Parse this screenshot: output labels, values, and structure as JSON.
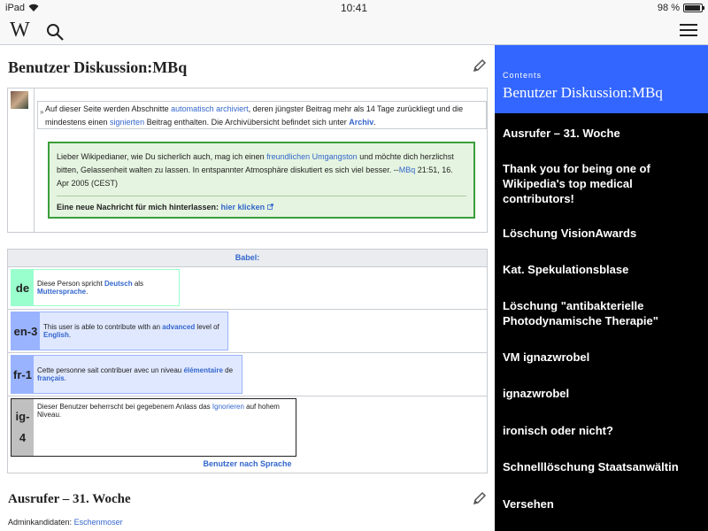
{
  "status": {
    "carrier": "iPad",
    "time": "10:41",
    "battery": "98 %"
  },
  "toolbar": {
    "logo": "W",
    "icons": [
      "wikipedia-logo",
      "search-icon",
      "menu-icon"
    ]
  },
  "page": {
    "title": "Benutzer Diskussion:MBq"
  },
  "archive_note": {
    "t1": "Auf dieser Seite werden Abschnitte ",
    "l1": "automatisch archiviert",
    "t2": ", deren jüngster Beitrag mehr als 14 Tage zurückliegt und die mindestens einen ",
    "l2": "signierten",
    "t3": " Beitrag enthalten. Die Archivübersicht befindet sich unter ",
    "l3": "Archiv",
    "t4": "."
  },
  "welcome": {
    "t1": "Lieber Wikipedianer, wie Du sicherlich auch, mag ich einen ",
    "l1": "freundlichen Umgangston",
    "t2": " und möchte dich herzlichst bitten, Gelassenheit walten zu lassen. In entspannter Atmosphäre diskutiert es sich viel besser. --",
    "l2": "MBq",
    "t3": " 21:51, 16. Apr 2005 (CEST)",
    "new_label": "Eine neue Nachricht für mich hinterlassen: ",
    "new_link": "hier klicken"
  },
  "babel": {
    "title": "Babel:",
    "footer": "Benutzer nach Sprache",
    "de": {
      "code": "de",
      "t1": "Diese Person spricht ",
      "l1": "Deutsch",
      "t2": " als ",
      "l2": "Muttersprache",
      "t3": ".",
      "color": "#99ffcc"
    },
    "en": {
      "code": "en-3",
      "t1": "This user is able to contribute with an ",
      "l1": "advanced",
      "t2": " level of ",
      "l2": "English",
      "t3": ".",
      "color": "#99b3ff"
    },
    "fr": {
      "code": "fr-1",
      "t1": "Cette personne sait contribuer avec un niveau ",
      "l1": "élémentaire",
      "t2": " de ",
      "l2": "français",
      "t3": ".",
      "color": "#99b3ff"
    },
    "ig": {
      "code1": "ig-",
      "code2": "4",
      "t1": "Dieser Benutzer beherrscht bei gegebenem Anlass das ",
      "l1": "Ignorieren",
      "t2": " auf hohem Niveau.",
      "color": "#c0c0c0"
    }
  },
  "section": {
    "title": "Ausrufer – 31. Woche",
    "label": "Adminkandidaten: ",
    "link": "Eschenmoser"
  },
  "toc": {
    "label": "Contents",
    "title": "Benutzer Diskussion:MBq",
    "items": [
      "Ausrufer – 31. Woche",
      "Thank you for being one of Wikipedia's top medical contributors!",
      "Löschung VisionAwards",
      "Kat. Spekulationsblase",
      "Löschung \"antibakterielle Photodynamische Therapie\"",
      "VM ignazwrobel",
      "ignazwrobel",
      "ironisch oder nicht?",
      "Schnelllöschung Staatsanwältin",
      "Versehen"
    ]
  }
}
